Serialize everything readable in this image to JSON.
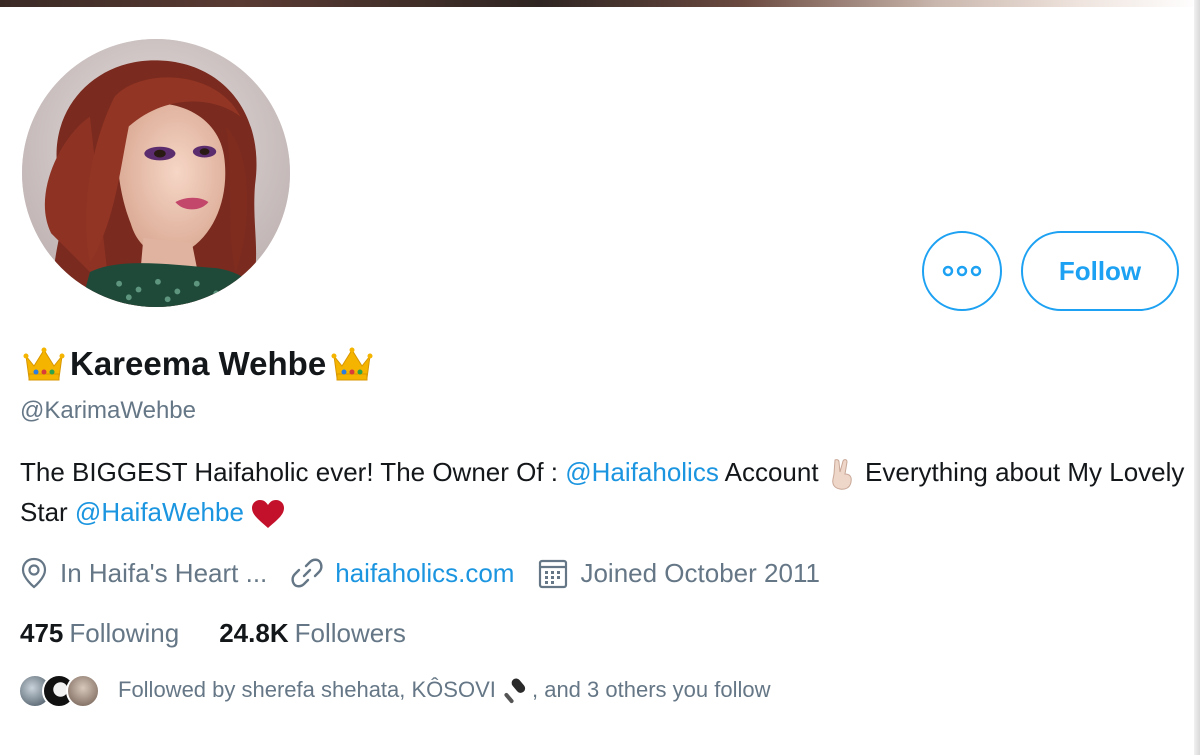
{
  "profile": {
    "display_name": "Kareema Wehbe",
    "handle": "@KarimaWehbe",
    "avatar_icon": "profile-photo"
  },
  "actions": {
    "more_icon": "more-options-icon",
    "follow_label": "Follow"
  },
  "bio": {
    "part1": "The BIGGEST Haifaholic ever! The Owner Of : ",
    "mention1": "@Haifaholics",
    "part2": " Account ",
    "part3": " Everything about My Lovely Star ",
    "mention2": "@HaifaWehbe",
    "part4": " "
  },
  "meta": {
    "location": "In Haifa's Heart ...",
    "website": "haifaholics.com",
    "joined": "Joined October 2011"
  },
  "stats": {
    "following_count": "475",
    "following_label": "Following",
    "followers_count": "24.8K",
    "followers_label": "Followers"
  },
  "followed_by": {
    "text_a": "Followed by sherefa shehata, KÔSOVI ",
    "text_b": ", and 3 others you follow"
  },
  "colors": {
    "accent": "#1da1f2",
    "link": "#1b95e0",
    "secondary_text": "#657786",
    "primary_text": "#14171a"
  }
}
